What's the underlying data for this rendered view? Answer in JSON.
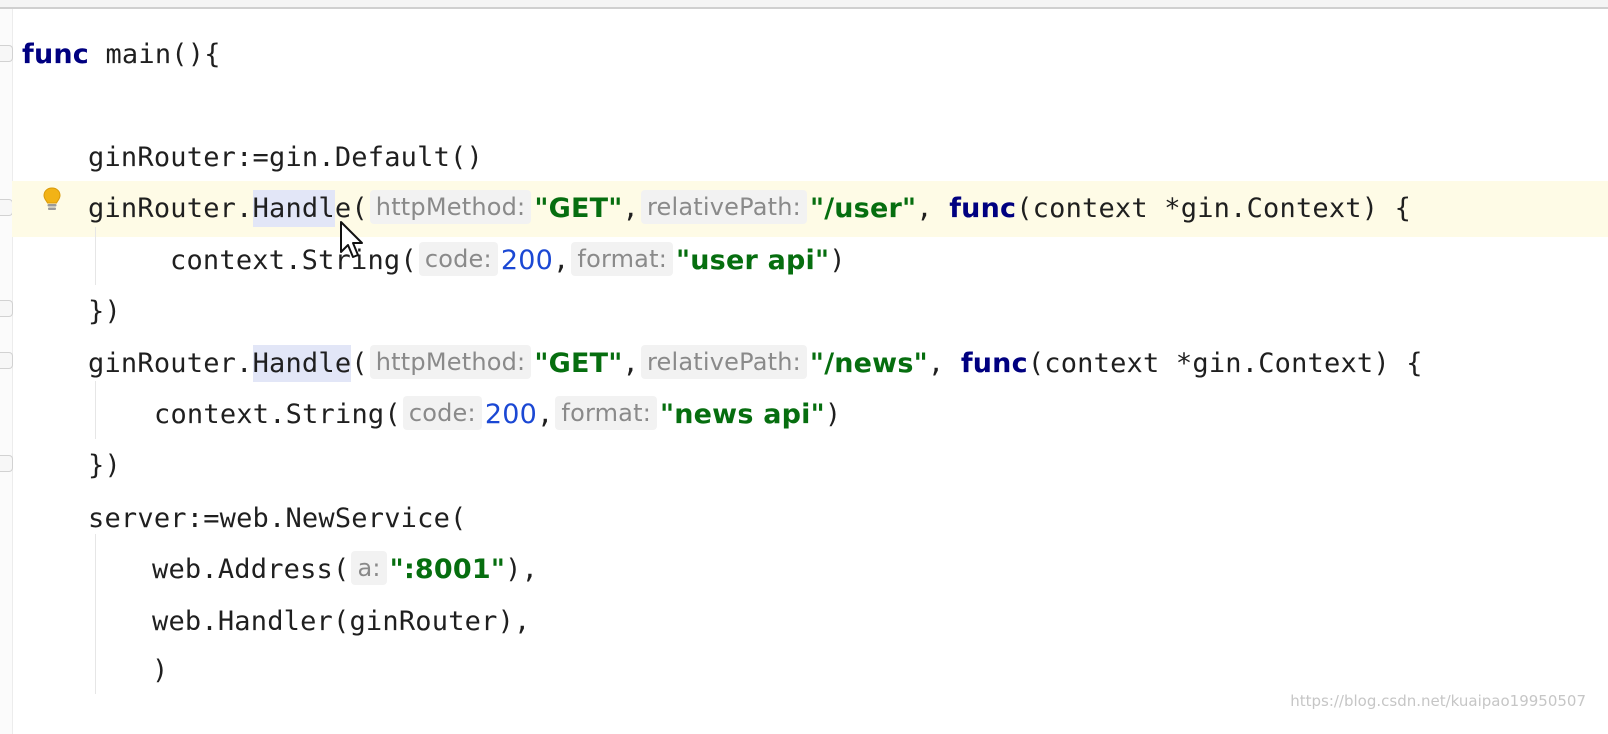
{
  "editor": {
    "lines": {
      "func_decl": {
        "keyword": "func",
        "rest": " main(){"
      },
      "default_call": {
        "text": "ginRouter:=gin.Default()"
      },
      "handle_user": {
        "receiver": "ginRouter.",
        "method_a": "Handl",
        "method_b": "e",
        "open_paren": "(",
        "hint_method": "httpMethod:",
        "method_value": "\"GET\"",
        "comma1": ",",
        "hint_path": "relativePath:",
        "path_value": "\"/user\"",
        "comma2": ",",
        "func_kw": "func",
        "func_rest": "(context *gin.Context) {"
      },
      "string_user": {
        "prefix": "context.String(",
        "hint_code": "code:",
        "code_value": "200",
        "comma": ",",
        "hint_format": "format:",
        "format_value": "\"user api\"",
        "close": ")"
      },
      "close_user": {
        "text": "})"
      },
      "handle_news": {
        "receiver": "ginRouter.",
        "method": "Handle",
        "open_paren": "(",
        "hint_method": "httpMethod:",
        "method_value": "\"GET\"",
        "comma1": ",",
        "hint_path": "relativePath:",
        "path_value": "\"/news\"",
        "comma2": ",",
        "func_kw": "func",
        "func_rest": "(context *gin.Context) {"
      },
      "string_news": {
        "prefix": "context.String(",
        "hint_code": "code:",
        "code_value": "200",
        "comma": ",",
        "hint_format": "format:",
        "format_value": "\"news api\"",
        "close": ")"
      },
      "close_news": {
        "text": "})"
      },
      "server_decl": {
        "text": "server:=web.NewService("
      },
      "address_call": {
        "prefix": "web.Address(",
        "hint_a": "a:",
        "value": "\":8001\"",
        "close": "),"
      },
      "handler_call": {
        "text": "web.Handler(ginRouter),"
      },
      "close_service": {
        "text": ")"
      }
    },
    "colors": {
      "keyword": "#000080",
      "string": "#066e0f",
      "number": "#1b48d4",
      "hint_text": "#8a8a8a",
      "current_line": "#fefbe6"
    },
    "icons": {
      "intention": "lightbulb-icon",
      "pointer": "mouse-cursor-icon"
    }
  },
  "watermark": "https://blog.csdn.net/kuaipao19950507"
}
